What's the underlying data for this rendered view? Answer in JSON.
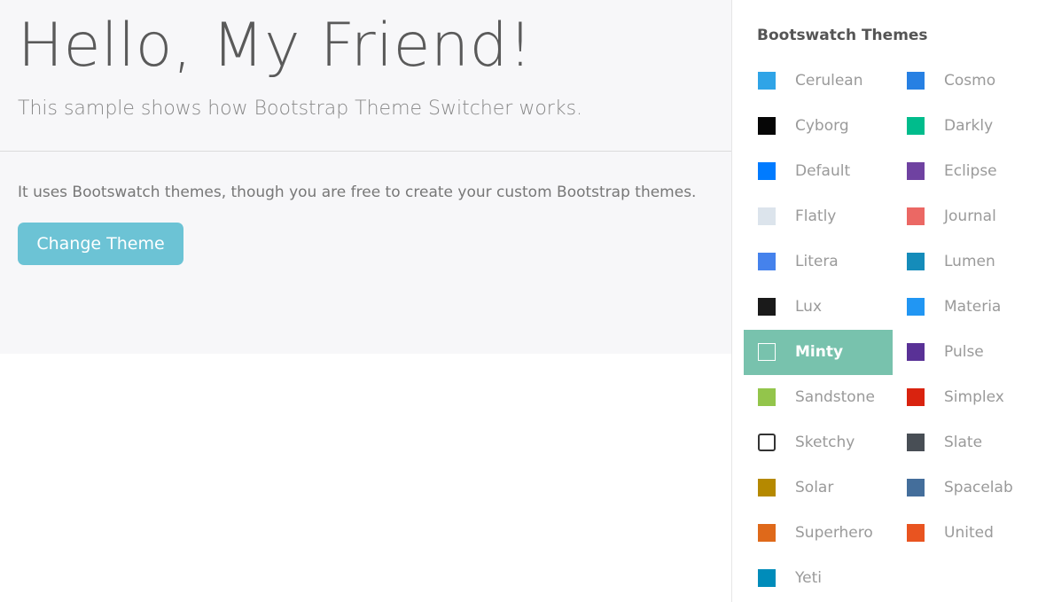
{
  "main": {
    "title": "Hello, My Friend!",
    "lead": "This sample shows how Bootstrap Theme Switcher works.",
    "body": "It uses Bootswatch themes, though you are free to create your custom Bootstrap themes.",
    "button_label": "Change Theme"
  },
  "colors": {
    "jumbotron_bg": "#f7f7f9",
    "button_bg": "#6cc3d5",
    "active_item_bg": "#78c2ad"
  },
  "sidebar": {
    "title": "Bootswatch Themes",
    "active_theme": "Minty",
    "themes": [
      {
        "name": "Cerulean",
        "color": "#2fa4e7",
        "icon": "color-swatch-icon"
      },
      {
        "name": "Cosmo",
        "color": "#2780e3",
        "icon": "color-swatch-icon"
      },
      {
        "name": "Cyborg",
        "color": "#060606",
        "icon": "color-swatch-icon"
      },
      {
        "name": "Darkly",
        "color": "#00bc8c",
        "icon": "color-swatch-icon"
      },
      {
        "name": "Default",
        "color": "#007bff",
        "icon": "color-swatch-icon"
      },
      {
        "name": "Eclipse",
        "color": "#6f42a1",
        "icon": "color-swatch-icon"
      },
      {
        "name": "Flatly",
        "color": "#dce4ec",
        "icon": "color-swatch-icon"
      },
      {
        "name": "Journal",
        "color": "#eb6864",
        "icon": "color-swatch-icon"
      },
      {
        "name": "Litera",
        "color": "#4582ec",
        "icon": "color-swatch-icon"
      },
      {
        "name": "Lumen",
        "color": "#158cba",
        "icon": "color-swatch-icon"
      },
      {
        "name": "Lux",
        "color": "#1a1a1a",
        "icon": "color-swatch-icon"
      },
      {
        "name": "Materia",
        "color": "#2196f3",
        "icon": "color-swatch-icon"
      },
      {
        "name": "Minty",
        "color": "#78c2ad",
        "icon": "color-swatch-icon"
      },
      {
        "name": "Pulse",
        "color": "#593196",
        "icon": "color-swatch-icon"
      },
      {
        "name": "Sandstone",
        "color": "#93c54b",
        "icon": "color-swatch-icon"
      },
      {
        "name": "Simplex",
        "color": "#d9230f",
        "icon": "color-swatch-icon"
      },
      {
        "name": "Sketchy",
        "color": "#ffffff",
        "icon": "color-swatch-icon"
      },
      {
        "name": "Slate",
        "color": "#484e55",
        "icon": "color-swatch-icon"
      },
      {
        "name": "Solar",
        "color": "#b58900",
        "icon": "color-swatch-icon"
      },
      {
        "name": "Spacelab",
        "color": "#446e9b",
        "icon": "color-swatch-icon"
      },
      {
        "name": "Superhero",
        "color": "#df691a",
        "icon": "color-swatch-icon"
      },
      {
        "name": "United",
        "color": "#e95420",
        "icon": "color-swatch-icon"
      },
      {
        "name": "Yeti",
        "color": "#008cba",
        "icon": "color-swatch-icon"
      }
    ]
  }
}
